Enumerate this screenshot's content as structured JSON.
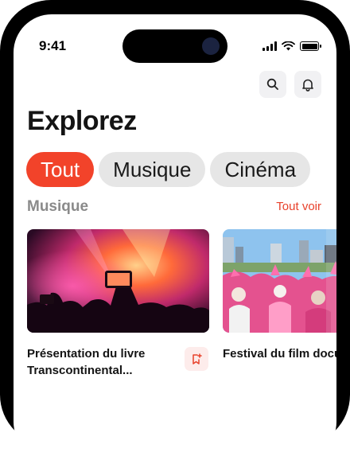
{
  "status_bar": {
    "time": "9:41"
  },
  "header": {
    "title": "Explorez"
  },
  "tabs": [
    {
      "label": "Tout",
      "active": true
    },
    {
      "label": "Musique",
      "active": false
    },
    {
      "label": "Cinéma",
      "active": false
    }
  ],
  "section": {
    "title": "Musique",
    "see_all": "Tout voir"
  },
  "cards": [
    {
      "title": "Présentation du livre Transcontinental...",
      "image": "concert-crowd-photo"
    },
    {
      "title": "Festival du film documentaire de la...",
      "image": "festival-crowd-photo"
    }
  ],
  "colors": {
    "accent": "#f2432a",
    "tab_bg": "#e6e6e6",
    "text": "#141414",
    "muted": "#8a8a8a"
  }
}
